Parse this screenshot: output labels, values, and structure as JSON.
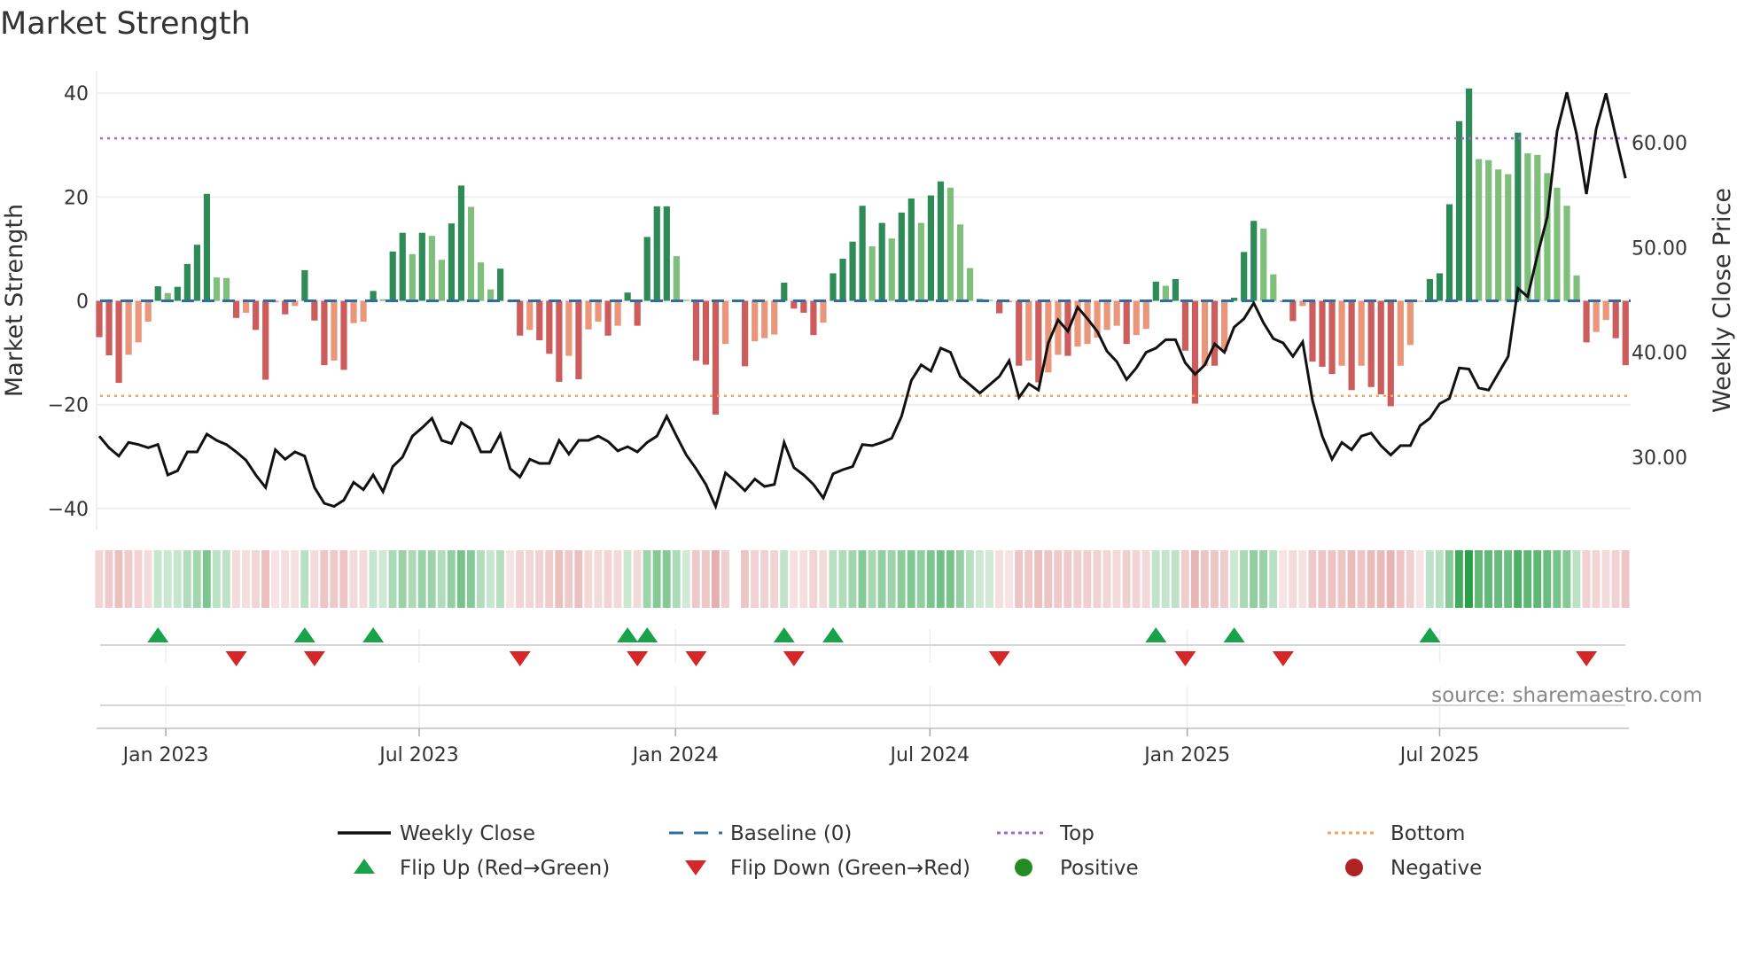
{
  "title": "Market Strength",
  "source": "source: sharemaestro.com",
  "chart_data": {
    "type": "bar",
    "title": "Market Strength",
    "ylabel": "Market Strength",
    "y2label": "Weekly Close Price",
    "ylim": [
      -44,
      44
    ],
    "y2lim": [
      23.5,
      66.5
    ],
    "yticks": [
      40,
      20,
      0,
      -20,
      -40
    ],
    "yticks_labels": [
      "40",
      "20",
      "0",
      "−20",
      "−40"
    ],
    "y2ticks": [
      60,
      50,
      40,
      30
    ],
    "y2ticks_labels": [
      "60.00",
      "50.00",
      "40.00",
      "30.00"
    ],
    "x_ticks": [
      {
        "label": "Jan 2023",
        "index": 6.8
      },
      {
        "label": "Jul 2023",
        "index": 32.7
      },
      {
        "label": "Jan 2024",
        "index": 58.9
      },
      {
        "label": "Jul 2024",
        "index": 84.9
      },
      {
        "label": "Jan 2025",
        "index": 111.2
      },
      {
        "label": "Jul 2025",
        "index": 137.0
      }
    ],
    "top_level": 31.3,
    "bottom_level": -18.3,
    "baseline": 0,
    "grid": true,
    "legend_position": "bottom",
    "strength": [
      -7,
      -10.5,
      -15.8,
      -10.4,
      -8,
      -4,
      2.8,
      1.5,
      2.7,
      7.1,
      10.8,
      20.6,
      4.5,
      4.4,
      -3.3,
      -2.3,
      -5.6,
      -15.2,
      -0.3,
      -2.6,
      -1,
      5.9,
      -3.8,
      -12.4,
      -11.5,
      -13.3,
      -4.3,
      -4,
      1.9,
      0.3,
      9.5,
      13.1,
      9,
      13.1,
      12.5,
      7.9,
      14.9,
      22.2,
      18.1,
      7.4,
      2.2,
      6.2,
      -0.2,
      -6.7,
      -5.6,
      -7.6,
      -10.2,
      -15.6,
      -10.6,
      -15.1,
      -5.5,
      -4,
      -6.7,
      -4.8,
      1.6,
      -4.8,
      12.3,
      18.2,
      18.2,
      8.6,
      0.2,
      -11.5,
      -12.3,
      -21.9,
      -8.3,
      0,
      -12.6,
      -7.8,
      -7.2,
      -6.5,
      3.5,
      -1.5,
      -2.3,
      -6.6,
      -4.2,
      5.3,
      8.1,
      11.4,
      18.3,
      10.5,
      15,
      12,
      17,
      19.7,
      15,
      20.3,
      23,
      21.8,
      14.7,
      6.3,
      0.4,
      0.2,
      -2.4,
      -0.3,
      -12.5,
      -11.5,
      -15.7,
      -13.8,
      -10.4,
      -10.6,
      -8.8,
      -8.3,
      -7.1,
      -5.6,
      -4.8,
      -8.3,
      -6.6,
      -5.4,
      3.7,
      2.9,
      4.2,
      -9.6,
      -19.8,
      -12.5,
      -12.5,
      -9.7,
      0.6,
      9.4,
      15.4,
      13.9,
      5.1,
      -0.2,
      -3.9,
      -1,
      -11.7,
      -12.7,
      -14.1,
      -12.5,
      -17.2,
      -12.5,
      -16.6,
      -18,
      -20.3,
      -12.5,
      -8.5,
      -0.2,
      4.2,
      5.3,
      18.6,
      34.6,
      40.9,
      27.3,
      27.1,
      25.3,
      24.4,
      32.4,
      28.4,
      28.1,
      24.6,
      21.8,
      18.3,
      4.9,
      -8,
      -6,
      -3.7,
      -7.2,
      -12.4
    ],
    "weekly_close": [
      32.0,
      30.9,
      30.1,
      31.4,
      31.2,
      30.9,
      31.2,
      28.3,
      28.7,
      30.5,
      30.5,
      32.2,
      31.6,
      31.2,
      30.5,
      29.7,
      28.3,
      27.1,
      30.7,
      29.8,
      30.5,
      30.1,
      27.1,
      25.6,
      25.3,
      25.9,
      27.6,
      26.9,
      28.3,
      26.7,
      29.1,
      30.0,
      32.0,
      32.8,
      33.7,
      31.6,
      31.3,
      33.3,
      32.7,
      30.5,
      30.5,
      32.2,
      28.9,
      28.1,
      29.8,
      29.4,
      29.4,
      31.6,
      30.3,
      31.6,
      31.6,
      32.0,
      31.5,
      30.6,
      31.0,
      30.5,
      31.4,
      32.0,
      33.9,
      32.0,
      30.2,
      28.9,
      27.4,
      25.3,
      28.5,
      27.7,
      26.8,
      27.9,
      27.2,
      27.4,
      31.4,
      29.0,
      28.3,
      27.4,
      26.1,
      28.4,
      28.8,
      29.1,
      31.2,
      31.1,
      31.4,
      31.8,
      33.9,
      37.3,
      38.8,
      38.2,
      40.4,
      40.0,
      37.7,
      36.9,
      36.1,
      36.9,
      37.7,
      39.2,
      35.7,
      37.0,
      36.4,
      40.9,
      43.1,
      42.0,
      44.3,
      43.2,
      42.0,
      40.1,
      39.1,
      37.4,
      38.5,
      40.0,
      40.4,
      41.2,
      41.2,
      39.0,
      37.9,
      38.8,
      40.8,
      40.0,
      42.4,
      43.2,
      44.7,
      42.8,
      41.3,
      40.9,
      39.6,
      41.0,
      35.4,
      32.0,
      29.8,
      31.4,
      30.7,
      32.0,
      32.3,
      31.1,
      30.2,
      31.1,
      31.1,
      33.0,
      33.7,
      35.1,
      35.6,
      38.5,
      38.4,
      36.6,
      36.4,
      38.0,
      39.6,
      46.1,
      45.3,
      49.3,
      52.9,
      61.1,
      64.8,
      60.8,
      55.1,
      61.3,
      64.7,
      60.6,
      56.6
    ],
    "flip_up_indices": [
      6,
      21,
      28,
      54,
      56,
      70,
      75,
      108,
      116,
      136
    ],
    "flip_down_indices": [
      14,
      22,
      43,
      55,
      61,
      71,
      92,
      111,
      121,
      152
    ],
    "legend": [
      {
        "label": "Weekly Close",
        "symbol": "line"
      },
      {
        "label": "Baseline (0)",
        "symbol": "dash"
      },
      {
        "label": "Top",
        "symbol": "dot-purple"
      },
      {
        "label": "Bottom",
        "symbol": "dot-orange"
      },
      {
        "label": "Flip Up (Red→Green)",
        "symbol": "triangle-up"
      },
      {
        "label": "Flip Down (Green→Red)",
        "symbol": "triangle-down"
      },
      {
        "label": "Positive",
        "symbol": "circle-green"
      },
      {
        "label": "Negative",
        "symbol": "circle-red"
      }
    ]
  },
  "colors": {
    "pos_strong": "#2e8b57",
    "pos_weak": "#7fbf7b",
    "neg_strong": "#cd5c5c",
    "neg_weak": "#e9967a",
    "baseline": "#2f6f9f",
    "top": "#a463e0",
    "bottom": "#f2a65a",
    "price": "#111111",
    "flip_up": "#18a34a",
    "flip_down": "#d62728",
    "positive": "#228b22",
    "negative": "#b22222"
  }
}
